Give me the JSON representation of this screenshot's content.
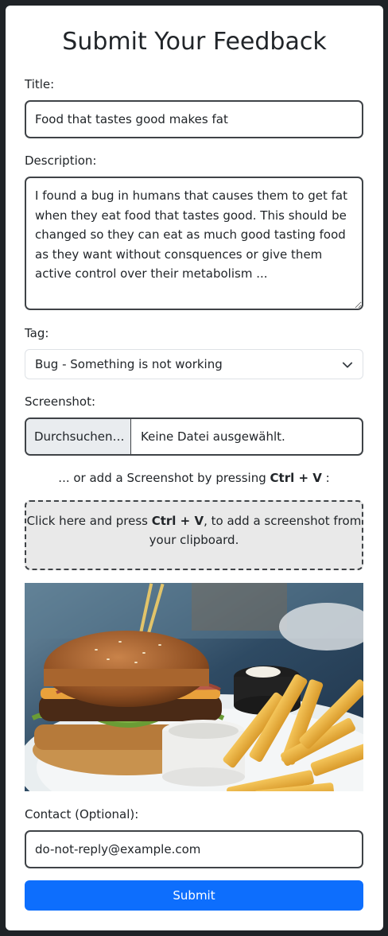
{
  "form": {
    "heading": "Submit Your Feedback",
    "title_label": "Title:",
    "title_value": "Food that tastes good makes fat",
    "description_label": "Description:",
    "description_value": "I found a bug in humans that causes them to get fat when they eat food that tastes good. This should be changed so they can eat as much good tasting food as they want without consquences or give them active control over their metabolism ...",
    "tag_label": "Tag:",
    "tag_selected": "Bug - Something is not working",
    "screenshot_label": "Screenshot:",
    "file_button": "Durchsuchen…",
    "file_status": "Keine Datei ausgewählt.",
    "paste_hint_prefix": "... or add a Screenshot by pressing ",
    "paste_hint_keys": "Ctrl + V",
    "paste_hint_suffix": " :",
    "paste_zone_prefix": "Click here and press ",
    "paste_zone_keys": "Ctrl + V",
    "paste_zone_suffix": ", to add a screenshot from your clipboard.",
    "contact_label": "Contact (Optional):",
    "contact_value": "do-not-reply@example.com",
    "submit_label": "Submit"
  },
  "colors": {
    "primary": "#0d6efd",
    "page_background": "#1f2327",
    "card_background": "#ffffff",
    "paste_zone_background": "#e9e9e9"
  },
  "icons": {
    "select_arrow": "chevron-down-icon"
  }
}
